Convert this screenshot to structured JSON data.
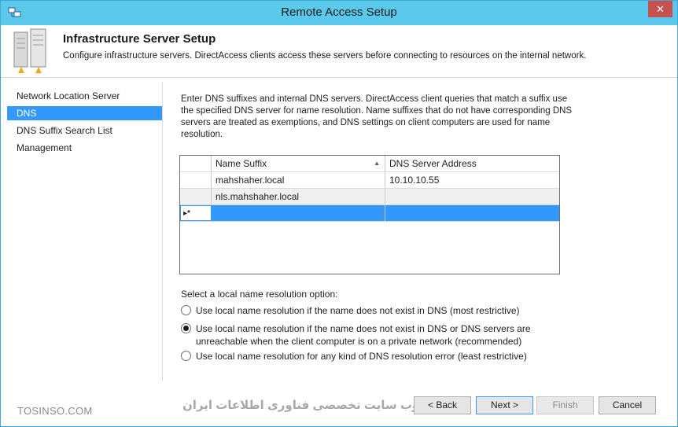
{
  "window": {
    "title": "Remote Access Setup",
    "close_glyph": "✕",
    "app_icon": "network-setup-icon"
  },
  "header": {
    "title": "Infrastructure Server Setup",
    "description": "Configure infrastructure servers. DirectAccess clients access these servers before connecting to resources on the internal network.",
    "icon": "server-icon"
  },
  "nav": {
    "items": [
      {
        "label": "Network Location Server",
        "active": false
      },
      {
        "label": "DNS",
        "active": true
      },
      {
        "label": "DNS Suffix Search List",
        "active": false
      },
      {
        "label": "Management",
        "active": false
      }
    ]
  },
  "main": {
    "intro": "Enter DNS suffixes and internal DNS servers.  DirectAccess client queries that match a suffix use the specified DNS server for name resolution. Name suffixes that do not have corresponding DNS servers are treated as exemptions, and DNS settings on client computers are used for name resolution.",
    "grid": {
      "columns": [
        "Name Suffix",
        "DNS Server Address"
      ],
      "sort_glyph": "▲",
      "rows": [
        [
          "mahshaher.local",
          "10.10.10.55"
        ],
        [
          "nls.mahshaher.local",
          ""
        ]
      ],
      "new_row_glyph": "▸*"
    },
    "options_label": "Select a local name resolution option:",
    "options": [
      {
        "text": "Use local name resolution if the name does not exist in DNS (most restrictive)",
        "checked": false
      },
      {
        "text": "Use local name resolution if the name does not exist in DNS or DNS servers are unreachable when the client computer is on a private network (recommended)",
        "checked": true
      },
      {
        "text": "Use local name resolution for any kind of DNS resolution error (least restrictive)",
        "checked": false
      }
    ]
  },
  "footer": {
    "back": "< Back",
    "next": "Next >",
    "finish": "Finish",
    "cancel": "Cancel"
  },
  "watermarks": {
    "left": "TOSINSO.COM",
    "right": "وب سایت تخصصی فناوری اطلاعات ایران"
  },
  "colors": {
    "titlebar": "#5ac8ea",
    "selection": "#3399ff",
    "close": "#c75050"
  }
}
